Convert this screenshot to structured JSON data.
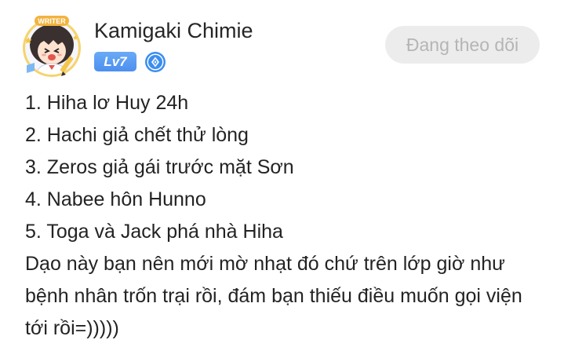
{
  "post": {
    "author": {
      "name": "Kamigaki Chimie",
      "level": "Lv7",
      "avatar_badge": "WRITER"
    },
    "follow_button": {
      "label": "Đang theo dõi"
    },
    "content": {
      "list": [
        "1. Hiha lơ Huy 24h",
        "2. Hachi giả chết thử lòng",
        "3. Zeros giả gái trước mặt Sơn",
        "4. Nabee hôn Hunno",
        "5. Toga và Jack phá nhà Hiha"
      ],
      "paragraph": "Dạo này bạn nên mới mờ nhạt đó chứ trên lớp giờ như bệnh nhân trốn trại rồi, đám bạn thiếu điều muốn gọi viện tới rồi=)))))"
    }
  },
  "icons": {
    "avatar": "anime-avatar-icon",
    "verify": "verified-diamond-icon"
  },
  "colors": {
    "level_badge": "#5b9cf2",
    "verify_badge": "#3b8ef0",
    "follow_button_bg": "#ececec",
    "follow_button_text": "#b5b5b5",
    "text": "#232323"
  }
}
